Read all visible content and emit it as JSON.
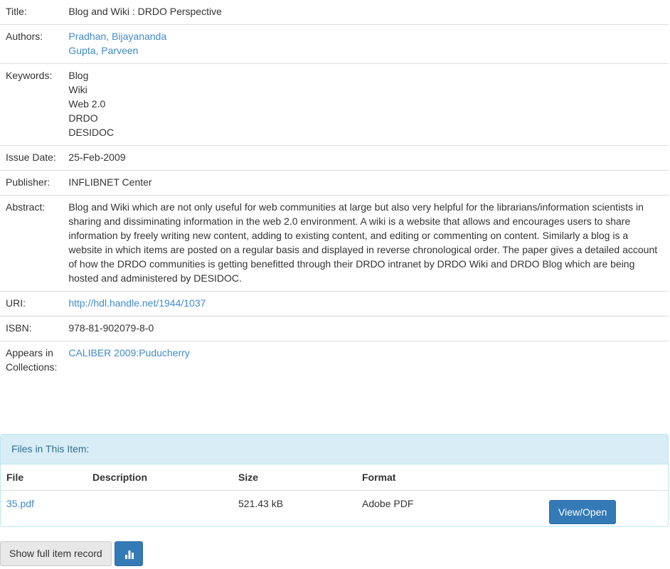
{
  "meta": {
    "title_label": "Title:",
    "title_value": "Blog and Wiki : DRDO Perspective",
    "authors_label": "Authors:",
    "authors": [
      "Pradhan, Bijayananda",
      "Gupta, Parveen"
    ],
    "keywords_label": "Keywords:",
    "keywords": [
      "Blog",
      "Wiki",
      "Web 2.0",
      "DRDO",
      "DESIDOC"
    ],
    "issue_label": "Issue Date:",
    "issue_value": "25-Feb-2009",
    "publisher_label": "Publisher:",
    "publisher_value": "INFLIBNET Center",
    "abstract_label": "Abstract:",
    "abstract_value": "Blog and Wiki which are not only useful for web communities at large but also very helpful for the librarians/information scientists in sharing and dissiminating information in the web 2.0 environment. A wiki is a website that allows and encourages users to share information by freely writing new content, adding to existing content, and editing or commenting on content. Similarly a blog is a website in which items are posted on a regular basis and displayed in reverse chronological order. The paper gives a detailed account of how the DRDO communities is getting benefitted through their DRDO intranet by DRDO Wiki and DRDO Blog which are being hosted and administered by DESIDOC.",
    "uri_label": "URI:",
    "uri_value": "http://hdl.handle.net/1944/1037",
    "isbn_label": "ISBN:",
    "isbn_value": "978-81-902079-8-0",
    "collections_label": "Appears in Collections:",
    "collections_value": "CALIBER 2009:Puducherry"
  },
  "files": {
    "heading": "Files in This Item:",
    "columns": [
      "File",
      "Description",
      "Size",
      "Format"
    ],
    "rows": [
      {
        "file": "35.pdf",
        "description": "",
        "size": "521.43 kB",
        "format": "Adobe PDF",
        "action": "View/Open"
      }
    ]
  },
  "footer": {
    "full_record_label": "Show full item record",
    "stats_icon": "bar-chart-icon"
  }
}
